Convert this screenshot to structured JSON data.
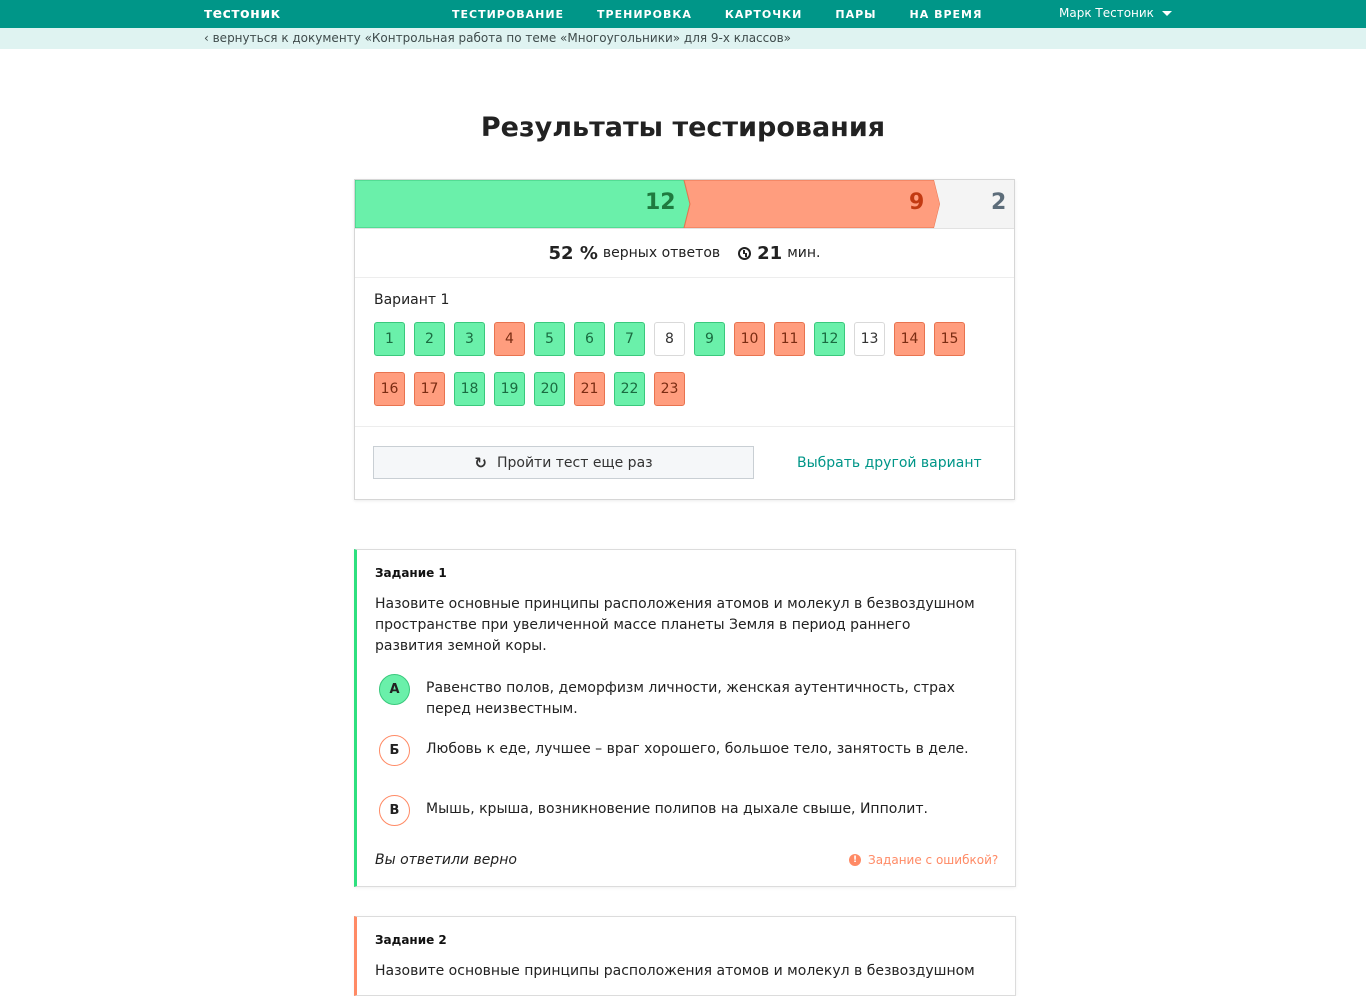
{
  "header": {
    "logo": "тестоник",
    "nav": [
      "ТЕСТИРОВАНИЕ",
      "ТРЕНИРОВКА",
      "КАРТОЧКИ",
      "ПАРЫ",
      "НА ВРЕМЯ"
    ],
    "user": "Марк Тестоник",
    "accent_color": "#009688"
  },
  "breadcrumb": "‹ вернуться к документу «Контрольная работа по теме «Многоугольники» для 9-х классов»",
  "page_title": "Результаты тестирования",
  "results": {
    "correct_count": "12",
    "wrong_count": "9",
    "skipped_count": "2",
    "percent": "52 %",
    "percent_label": "верных ответов",
    "time": "21",
    "time_unit": "мин.",
    "variant_title": "Вариант 1",
    "questions": [
      {
        "n": "1",
        "status": "ok"
      },
      {
        "n": "2",
        "status": "ok"
      },
      {
        "n": "3",
        "status": "ok"
      },
      {
        "n": "4",
        "status": "bad"
      },
      {
        "n": "5",
        "status": "ok"
      },
      {
        "n": "6",
        "status": "ok"
      },
      {
        "n": "7",
        "status": "ok"
      },
      {
        "n": "8",
        "status": "skip"
      },
      {
        "n": "9",
        "status": "ok"
      },
      {
        "n": "10",
        "status": "bad"
      },
      {
        "n": "11",
        "status": "bad"
      },
      {
        "n": "12",
        "status": "ok"
      },
      {
        "n": "13",
        "status": "skip"
      },
      {
        "n": "14",
        "status": "bad"
      },
      {
        "n": "15",
        "status": "bad"
      },
      {
        "n": "16",
        "status": "bad"
      },
      {
        "n": "17",
        "status": "bad"
      },
      {
        "n": "18",
        "status": "ok"
      },
      {
        "n": "19",
        "status": "ok"
      },
      {
        "n": "20",
        "status": "ok"
      },
      {
        "n": "21",
        "status": "bad"
      },
      {
        "n": "22",
        "status": "ok"
      },
      {
        "n": "23",
        "status": "bad"
      }
    ],
    "retry_label": "Пройти тест еще раз",
    "other_variant_label": "Выбрать другой вариант",
    "colors": {
      "correct": "#6af0aa",
      "wrong": "#ff9d7e",
      "skipped": "#f4f4f4"
    }
  },
  "tasks": [
    {
      "title": "Задание 1",
      "text": "Назовите основные принципы расположения атомов и молекул в безвоздушном пространстве при увеличенной массе планеты Земля в период раннего развития земной коры.",
      "options": [
        {
          "letter": "А",
          "text": "Равенство полов, деморфизм личности, женская аутентичность, страх перед неизвестным."
        },
        {
          "letter": "Б",
          "text": "Любовь к еде, лучшее – враг хорошего, большое тело, занятость в деле."
        },
        {
          "letter": "В",
          "text": "Мышь, крыша, возникновение полипов на дыхале свыше, Ипполит."
        }
      ],
      "verdict": "Вы ответили верно",
      "report_label": "Задание с ошибкой?"
    },
    {
      "title": "Задание 2",
      "text": "Назовите основные принципы расположения атомов и молекул в безвоздушном"
    }
  ]
}
